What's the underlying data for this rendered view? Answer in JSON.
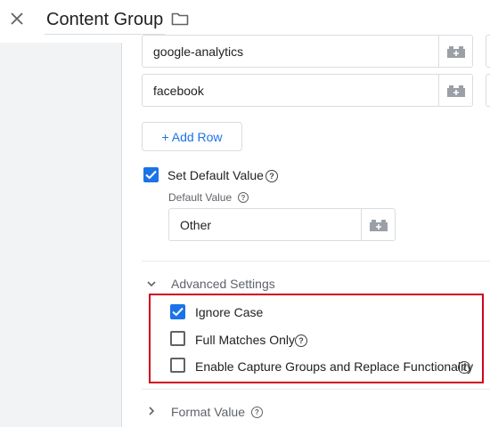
{
  "header": {
    "title": "Content Group",
    "close_icon": "close-icon",
    "folder_icon": "folder-icon"
  },
  "table": {
    "rows": [
      {
        "value": "google-analytics",
        "variable_icon": "variable-brick-icon"
      },
      {
        "value": "facebook",
        "variable_icon": "variable-brick-icon"
      }
    ],
    "add_row_label": "+ Add Row"
  },
  "default_value": {
    "checkbox_label": "Set Default Value",
    "checked": true,
    "field_label": "Default Value",
    "field_value": "Other"
  },
  "advanced": {
    "title": "Advanced Settings",
    "options": [
      {
        "label": "Ignore Case",
        "checked": true,
        "help": false
      },
      {
        "label": "Full Matches Only",
        "checked": false,
        "help": true
      },
      {
        "label": "Enable Capture Groups and Replace Functionality",
        "checked": false,
        "help": true
      }
    ]
  },
  "format_value": {
    "title": "Format Value"
  },
  "colors": {
    "accent": "#1a73e8",
    "highlight_border": "#d0021b"
  }
}
